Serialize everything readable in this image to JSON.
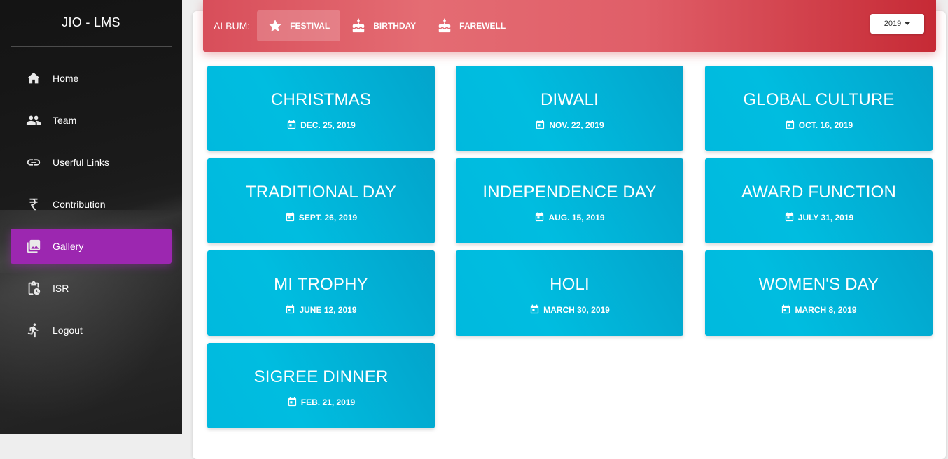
{
  "app": {
    "title": "JIO - LMS"
  },
  "sidebar": {
    "items": [
      {
        "label": "Home",
        "icon": "home-icon",
        "active": false
      },
      {
        "label": "Team",
        "icon": "people-icon",
        "active": false
      },
      {
        "label": "Userful Links",
        "icon": "link-icon",
        "active": false
      },
      {
        "label": "Contribution",
        "icon": "rupee-icon",
        "active": false
      },
      {
        "label": "Gallery",
        "icon": "photo-library-icon",
        "active": true
      },
      {
        "label": "ISR",
        "icon": "clipboard-clock-icon",
        "active": false
      },
      {
        "label": "Logout",
        "icon": "running-icon",
        "active": false
      }
    ],
    "active_color": "#9c27b0"
  },
  "album_bar": {
    "label": "ALBUM:",
    "tabs": [
      {
        "label": "FESTIVAL",
        "icon": "star-icon",
        "active": true
      },
      {
        "label": "BIRTHDAY",
        "icon": "cake-icon",
        "active": false
      },
      {
        "label": "FAREWELL",
        "icon": "cake-icon",
        "active": false
      }
    ],
    "year_selected": "2019",
    "color": "#e05e68"
  },
  "albums": [
    {
      "title": "CHRISTMAS",
      "date": "DEC. 25, 2019"
    },
    {
      "title": "DIWALI",
      "date": "NOV. 22, 2019"
    },
    {
      "title": "GLOBAL CULTURE",
      "date": "OCT. 16, 2019"
    },
    {
      "title": "TRADITIONAL DAY",
      "date": "SEPT. 26, 2019"
    },
    {
      "title": "INDEPENDENCE DAY",
      "date": "AUG. 15, 2019"
    },
    {
      "title": "AWARD FUNCTION",
      "date": "JULY 31, 2019"
    },
    {
      "title": "MI TROPHY",
      "date": "JUNE 12, 2019"
    },
    {
      "title": "HOLI",
      "date": "MARCH 30, 2019"
    },
    {
      "title": "WOMEN'S DAY",
      "date": "MARCH 8, 2019"
    },
    {
      "title": "SIGREE DINNER",
      "date": "FEB. 21, 2019"
    }
  ],
  "colors": {
    "card": "#00b9de"
  }
}
